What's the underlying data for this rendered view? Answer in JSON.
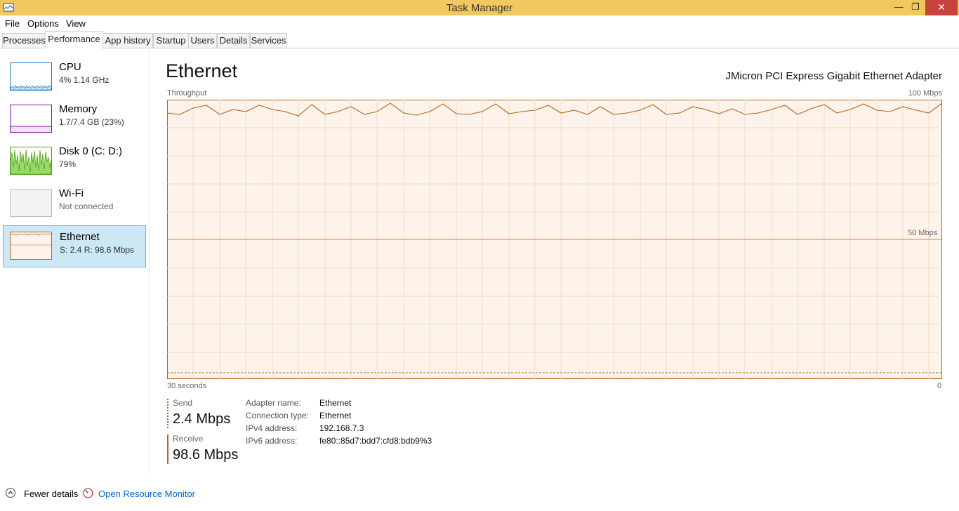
{
  "window": {
    "title": "Task Manager",
    "minimize": "—",
    "maximize": "❐",
    "close": "✕"
  },
  "menu": {
    "file": "File",
    "options": "Options",
    "view": "View"
  },
  "tabs": [
    {
      "label": "Processes"
    },
    {
      "label": "Performance"
    },
    {
      "label": "App history"
    },
    {
      "label": "Startup"
    },
    {
      "label": "Users"
    },
    {
      "label": "Details"
    },
    {
      "label": "Services"
    }
  ],
  "sidebar": {
    "items": [
      {
        "title": "CPU",
        "sub": "4%  1.14 GHz"
      },
      {
        "title": "Memory",
        "sub": "1.7/7.4 GB (23%)"
      },
      {
        "title": "Disk 0 (C: D:)",
        "sub": "79%"
      },
      {
        "title": "Wi-Fi",
        "sub": "Not connected"
      },
      {
        "title": "Ethernet",
        "sub": "S: 2.4  R: 98.6 Mbps"
      }
    ]
  },
  "main": {
    "title": "Ethernet",
    "adapter": "JMicron PCI Express Gigabit Ethernet Adapter",
    "throughput_label": "Throughput",
    "max_label": "100 Mbps",
    "mid_label": "50 Mbps",
    "time_label": "30 seconds",
    "zero_label": "0"
  },
  "stats": {
    "send_label": "Send",
    "send_value": "2.4 Mbps",
    "receive_label": "Receive",
    "receive_value": "98.6 Mbps"
  },
  "details": [
    {
      "key": "Adapter name:",
      "value": "Ethernet"
    },
    {
      "key": "Connection type:",
      "value": "Ethernet"
    },
    {
      "key": "IPv4 address:",
      "value": "192.168.7.3"
    },
    {
      "key": "IPv6 address:",
      "value": "fe80::85d7:bdd7:cfd8:bdb9%3"
    }
  ],
  "footer": {
    "fewer_details": "Fewer details",
    "open_monitor": "Open Resource Monitor"
  },
  "colors": {
    "accent": "#b8651b",
    "graph_fill": "#fdf3ea",
    "grid": "#f0dcc9",
    "select_bg": "#cce8f5"
  },
  "icons": {
    "app": "task-manager-icon",
    "fewer": "chevron-up-icon",
    "monitor": "resource-monitor-icon"
  }
}
